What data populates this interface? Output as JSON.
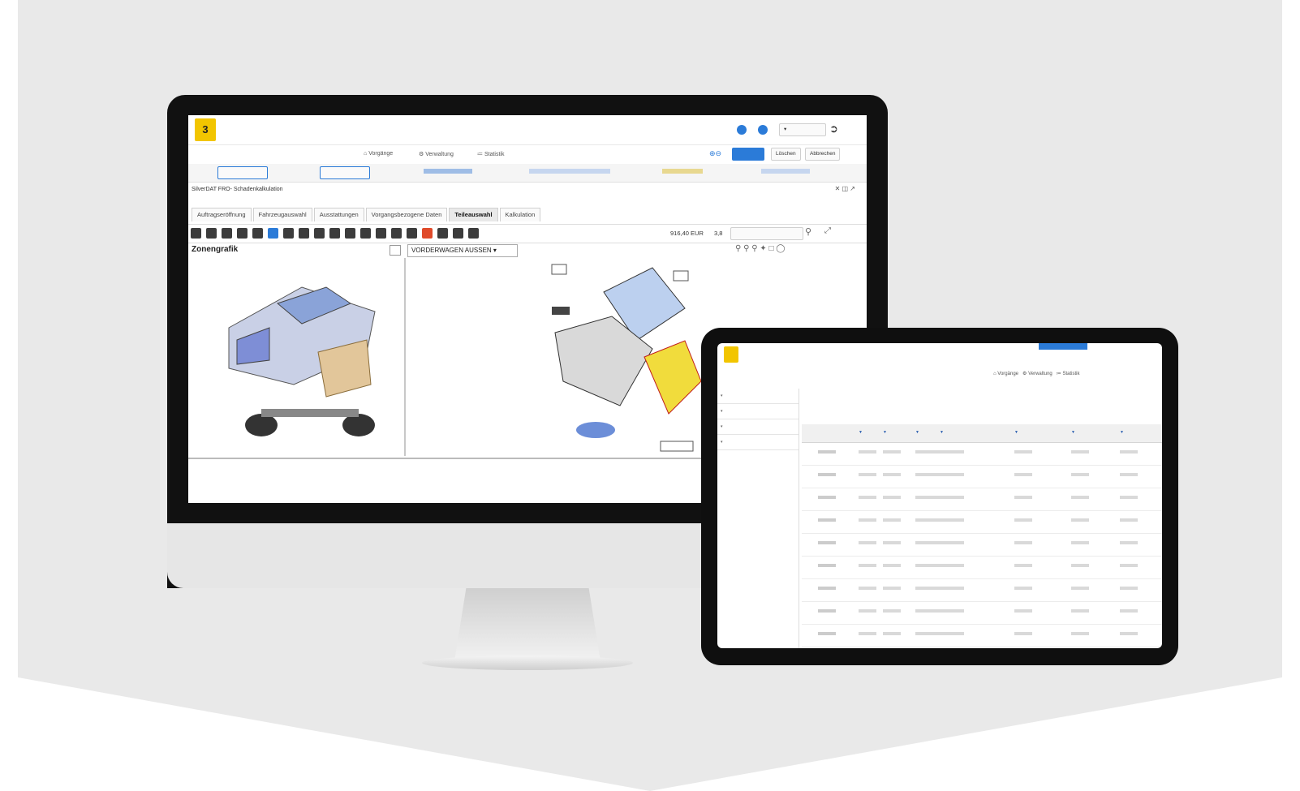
{
  "colors": {
    "accent": "#2b7bd8",
    "logo": "#f2c500",
    "background": "#e9e9e9"
  },
  "desktop": {
    "nav": {
      "tabs": [
        "Vorgänge",
        "Verwaltung",
        "Statistik"
      ]
    },
    "header_buttons": [
      "Löschen",
      "Abbrechen"
    ],
    "title": "SilverDAT FRO- Schadenkalkulation",
    "tabs": [
      "Auftragseröffnung",
      "Fahrzeugauswahl",
      "Ausstattungen",
      "Vorgangsbezogene Daten",
      "Teileauswahl",
      "Kalkulation"
    ],
    "active_tab": "Teileauswahl",
    "price": "916,40 EUR",
    "price_qty": "3,8",
    "left_panel_title": "Zonengrafik",
    "view_select": "VORDERWAGEN AUSSEN"
  },
  "tablet": {
    "nav": {
      "tabs": [
        "Vorgänge",
        "Verwaltung",
        "Statistik"
      ]
    }
  }
}
